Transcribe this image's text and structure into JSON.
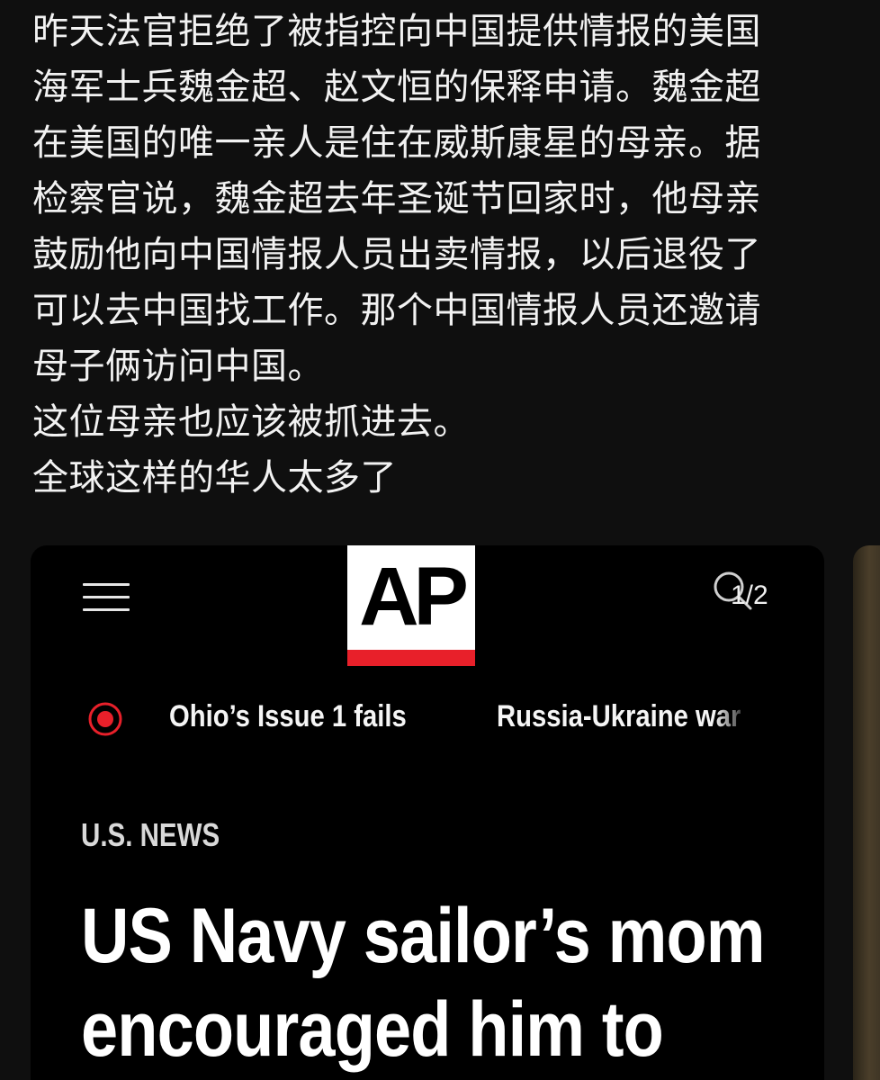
{
  "post": {
    "lines": [
      "昨天法官拒绝了被指控向中国提供情报的美国",
      "海军士兵魏金超、赵文恒的保释申请。魏金超",
      "在美国的唯一亲人是住在威斯康星的母亲。据",
      "检察官说，魏金超去年圣诞节回家时，他母亲",
      "鼓励他向中国情报人员出卖情报，以后退役了",
      "可以去中国找工作。那个中国情报人员还邀请",
      "母子俩访问中国。",
      "这位母亲也应该被抓进去。",
      "全球这样的华人太多了"
    ]
  },
  "image_card": {
    "counter": "1/2",
    "logo_text": "AP",
    "colors": {
      "logo_background": "#ffffff",
      "logo_bar": "#e8202a",
      "live_icon": "#e8202a",
      "card_background": "#000000"
    },
    "icons": {
      "menu": "hamburger-menu-icon",
      "search": "search-icon",
      "live": "live-indicator-icon"
    },
    "trending": [
      {
        "label": "Ohio’s Issue 1 fails"
      },
      {
        "label": "Russia-Ukraine war"
      }
    ],
    "section": "U.S. NEWS",
    "headline_lines": [
      "US Navy sailor’s mom",
      "encouraged him to"
    ]
  }
}
